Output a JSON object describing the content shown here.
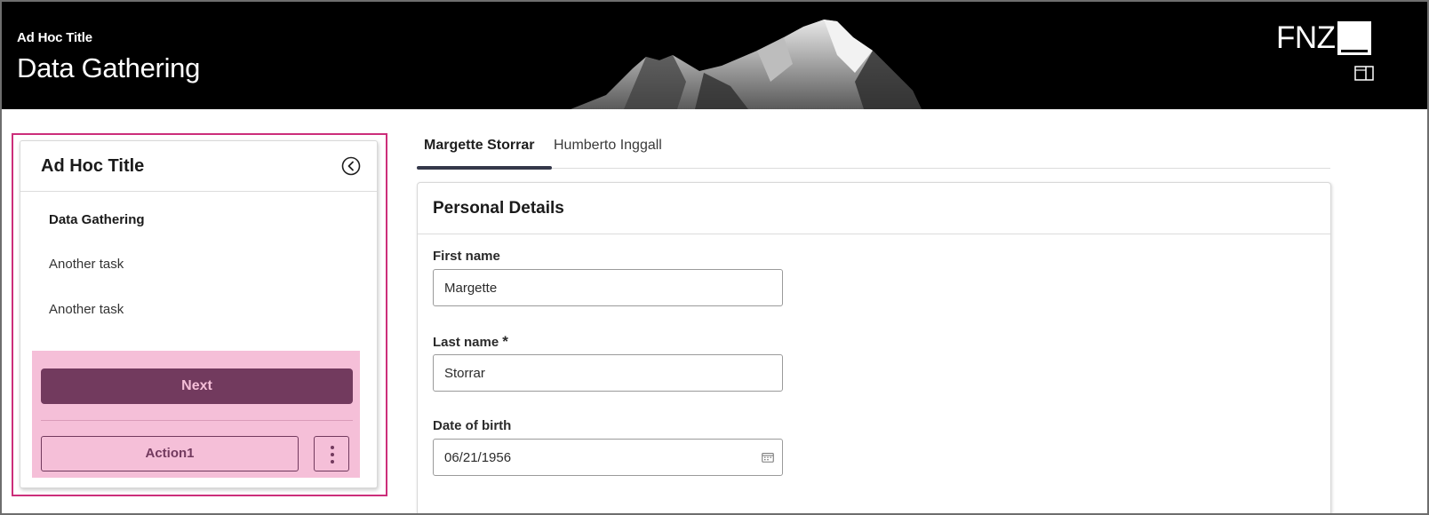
{
  "header": {
    "subtitle": "Ad Hoc Title",
    "title": "Data Gathering",
    "logo_text": "FNZ"
  },
  "side_panel": {
    "title": "Ad Hoc Title",
    "tasks": [
      {
        "label": "Data Gathering",
        "active": true
      },
      {
        "label": "Another task",
        "active": false
      },
      {
        "label": "Another task",
        "active": false
      }
    ],
    "next_label": "Next",
    "action1_label": "Action1"
  },
  "tabs": [
    {
      "label": "Margette Storrar",
      "active": true
    },
    {
      "label": "Humberto Inggall",
      "active": false
    }
  ],
  "personal_details": {
    "title": "Personal Details",
    "first_name": {
      "label": "First name",
      "value": "Margette"
    },
    "last_name": {
      "label": "Last name",
      "required_mark": "*",
      "value": "Storrar"
    },
    "date_of_birth": {
      "label": "Date of birth",
      "value": "06/21/1956"
    }
  },
  "colors": {
    "header_bg": "#000000",
    "highlight_border": "#cc2e7a",
    "actions_bg": "#f5bfd8",
    "primary": "#723a5e",
    "tab_underline": "#34384a"
  },
  "icons": [
    "panel-toggle-icon",
    "collapse-left-icon",
    "more-vertical-icon",
    "calendar-icon"
  ]
}
